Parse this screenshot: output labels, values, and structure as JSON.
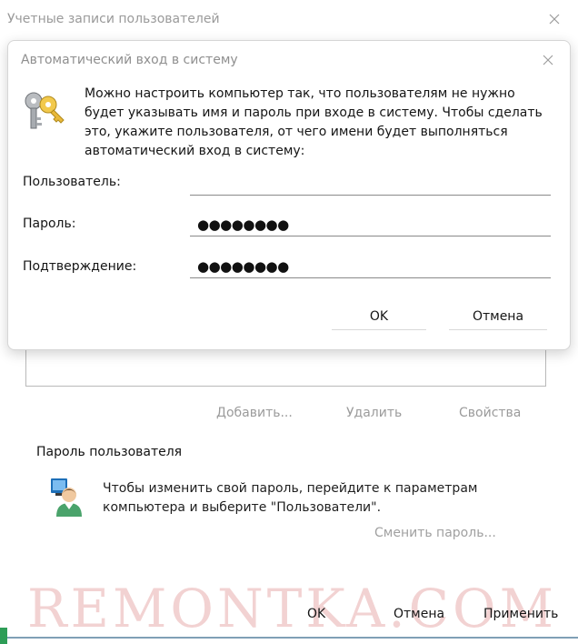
{
  "background_window": {
    "title": "Учетные записи пользователей",
    "buttons": {
      "add": "Добавить...",
      "remove": "Удалить",
      "properties": "Свойства"
    },
    "password_section": {
      "title": "Пароль пользователя",
      "info": "Чтобы изменить свой пароль, перейдите к параметрам компьютера и выберите \"Пользователи\".",
      "change_password": "Сменить пароль..."
    },
    "footer": {
      "ok": "OK",
      "cancel": "Отмена",
      "apply": "Применить"
    },
    "watermark": "REMONTKA.COM"
  },
  "dialog": {
    "title": "Автоматический вход в систему",
    "description": "Можно настроить компьютер так, что пользователям не нужно будет указывать имя и пароль при входе в систему. Чтобы сделать это, укажите пользователя, от чего имени будет выполняться автоматический вход в систему:",
    "fields": {
      "user_label": "Пользователь:",
      "user_value": "",
      "password_label": "Пароль:",
      "password_mask": "●●●●●●●●",
      "confirm_label": "Подтверждение:",
      "confirm_mask": "●●●●●●●●"
    },
    "buttons": {
      "ok": "OK",
      "cancel": "Отмена"
    }
  },
  "icons": {
    "close": "close-icon",
    "keys": "keys-icon",
    "user": "user-account-icon"
  },
  "colors": {
    "disabled_text": "#9b9b9b",
    "watermark": "#f2d2d2",
    "accent_green": "#2e9d57"
  }
}
